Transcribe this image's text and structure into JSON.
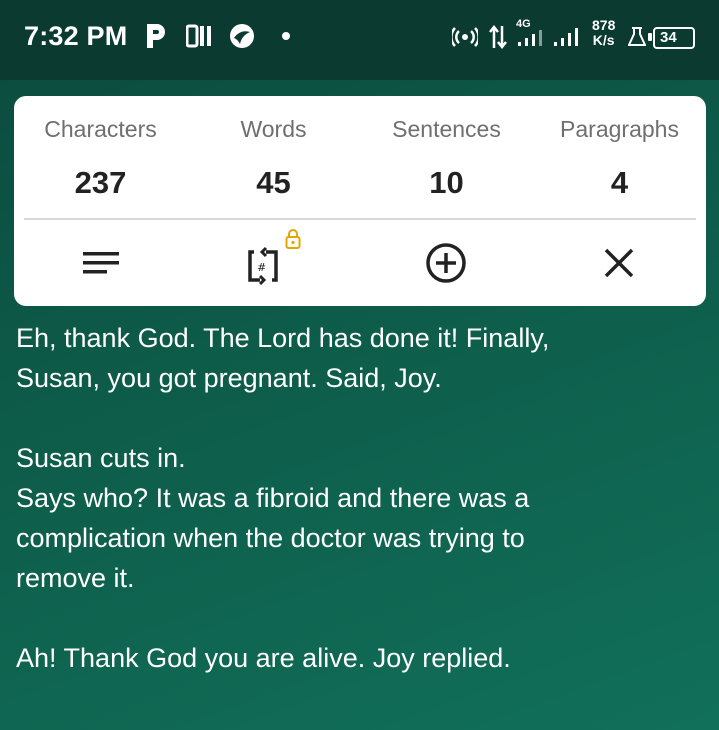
{
  "status_bar": {
    "time": "7:32 PM",
    "network_type": "4G",
    "net_speed_value": "878",
    "net_speed_unit": "K/s",
    "battery": "34"
  },
  "stats": [
    {
      "label": "Characters",
      "value": "237"
    },
    {
      "label": "Words",
      "value": "45"
    },
    {
      "label": "Sentences",
      "value": "10"
    },
    {
      "label": "Paragraphs",
      "value": "4"
    }
  ],
  "toolbar": {
    "lock_color": "#e0a800"
  },
  "content": {
    "lines": [
      "Eh, thank God. The Lord has done it! Finally,",
      "Susan, you got pregnant. Said, Joy.",
      "",
      "Susan cuts in.",
      "Says who? It was a fibroid and there was a",
      "complication when the doctor was trying to",
      "remove it.",
      "",
      "Ah! Thank God you are alive. Joy replied."
    ]
  }
}
